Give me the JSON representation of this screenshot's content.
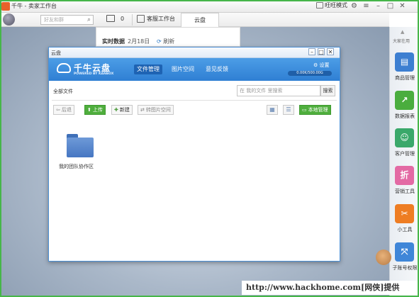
{
  "titlebar": {
    "app_title": "千牛 - 卖家工作台",
    "mode_label": "旺旺模式",
    "icons": [
      "mode-box-icon",
      "settings-gear-icon",
      "menu-icon",
      "minimize-icon",
      "restore-icon",
      "close-icon"
    ]
  },
  "toolbar": {
    "search_placeholder": "好友和群",
    "mail_count": "0",
    "service_label": "客服工作台",
    "active_tab": "云盘"
  },
  "live_panel": {
    "title": "实时数据",
    "date": "2月18日",
    "refresh_label": "刷新"
  },
  "window": {
    "title": "云盘",
    "brand": "千牛云盘",
    "brand_sub": "POWERED BY KANBOX",
    "tabs": [
      {
        "label": "文件管理",
        "active": true
      },
      {
        "label": "图片空间",
        "active": false
      },
      {
        "label": "意见反馈",
        "active": false
      }
    ],
    "settings_label": "设置",
    "quota_text": "0.00K/500.00G",
    "breadcrumb": "全部文件",
    "search_placeholder": "在 我的文件 里搜索",
    "search_button": "搜索",
    "buttons": {
      "back": "后退",
      "upload": "上传",
      "new": "新建",
      "to_image_space": "转图片空间",
      "local_manage": "本地管理"
    },
    "folder": {
      "label": "我的团队协作区"
    }
  },
  "sidebar": {
    "top_label": "大家在用",
    "items": [
      {
        "label": "商品管理",
        "color": "#3d7fd1",
        "icon": "product-icon"
      },
      {
        "label": "数据报表",
        "color": "#4aad3e",
        "icon": "chart-icon"
      },
      {
        "label": "客户管理",
        "color": "#3aa86a",
        "icon": "customer-icon"
      },
      {
        "label": "营销工具",
        "color": "#e36aa4",
        "icon": "marketing-icon"
      },
      {
        "label": "小工具",
        "color": "#ee7d23",
        "icon": "tools-icon"
      },
      {
        "label": "子账号权限",
        "color": "#3f86d8",
        "icon": "subaccount-icon"
      }
    ]
  },
  "watermark": "http://www.hackhome.com[网侠]提供"
}
